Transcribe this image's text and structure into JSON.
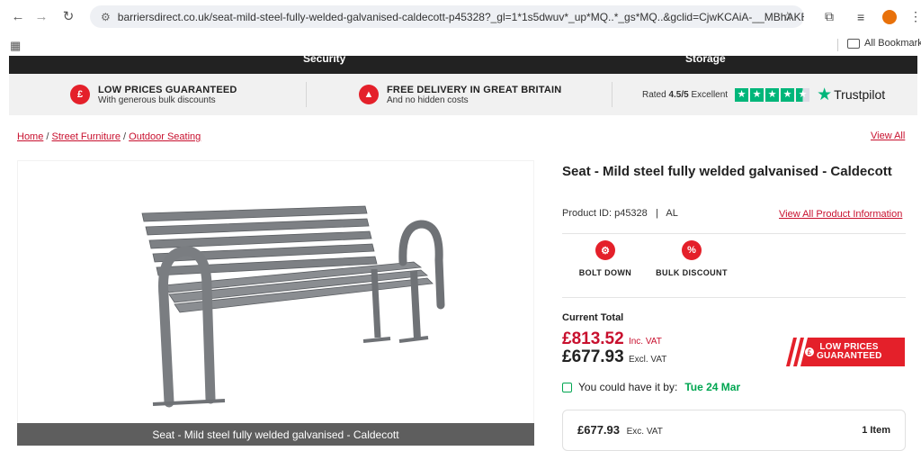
{
  "browser": {
    "url": "barriersdirect.co.uk/seat-mild-steel-fully-welded-galvanised-caldecott-p45328?_gl=1*1s5dwuv*_up*MQ..*_gs*MQ..&gclid=CjwKCAiA-__MBhAKEi...",
    "bookmarks_label": "All Bookmarks"
  },
  "nav": {
    "left_label": "Security",
    "right_label": "Storage"
  },
  "usps": [
    {
      "title": "LOW PRICES GUARANTEED",
      "subtitle": "With generous bulk discounts",
      "icon": "price-tag-icon"
    },
    {
      "title": "FREE DELIVERY IN GREAT BRITAIN",
      "subtitle": "And no hidden costs",
      "icon": "delivery-icon"
    }
  ],
  "trustpilot": {
    "rated_prefix": "Rated",
    "rating": "4.5/5",
    "rating_word": "Excellent",
    "logo_text": "Trustpilot",
    "stars": 4.5,
    "color": "#00b67a"
  },
  "breadcrumb": {
    "items": [
      "Home",
      "Street Furniture",
      "Outdoor Seating"
    ],
    "separator": "/",
    "view_all": "View All"
  },
  "product": {
    "title": "Seat - Mild steel fully welded galvanised - Caldecott",
    "id_label": "Product ID: p45328",
    "id_sep": "|",
    "brand_code": "AL",
    "info_link": "View All Product Information",
    "image_caption": "Seat - Mild steel fully welded galvanised - Caldecott"
  },
  "features": [
    {
      "label": "BOLT DOWN",
      "icon": "bolt-down-icon"
    },
    {
      "label": "BULK DISCOUNT",
      "icon": "percent-tag-icon"
    }
  ],
  "pricing": {
    "current_total_label": "Current Total",
    "inc_vat_price": "£813.52",
    "inc_vat_label": "Inc. VAT",
    "ex_vat_price": "£677.93",
    "ex_vat_label": "Excl. VAT",
    "badge_line1": "LOW PRICES",
    "badge_line2": "GUARANTEED",
    "accent_color": "#c8102e"
  },
  "delivery": {
    "label": "You could have it by:",
    "date": "Tue 24 Mar",
    "color": "#00a651"
  },
  "summary": {
    "price": "£677.93",
    "vat_label": "Exc. VAT",
    "items": "1 Item"
  }
}
